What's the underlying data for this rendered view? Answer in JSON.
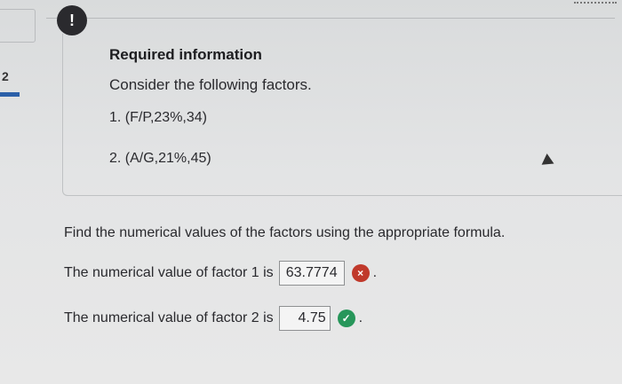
{
  "nav": {
    "question_number": "2"
  },
  "alert": {
    "symbol": "!"
  },
  "info": {
    "heading": "Required information",
    "intro": "Consider the following factors.",
    "factors": [
      "1. (F/P,23%,34)",
      "2. (A/G,21%,45)"
    ]
  },
  "question": {
    "prompt": "Find the numerical values of the factors using the appropriate formula.",
    "answers": [
      {
        "label": "The numerical value of factor 1 is",
        "value": "63.7774",
        "status": "incorrect",
        "status_icon": "x-circle-icon",
        "status_symbol": "×",
        "status_color": "#c0392b"
      },
      {
        "label": "The numerical value of factor 2 is",
        "value": "4.75",
        "status": "correct",
        "status_icon": "check-circle-icon",
        "status_symbol": "✓",
        "status_color": "#27965a"
      }
    ],
    "trailing_punct": "."
  }
}
